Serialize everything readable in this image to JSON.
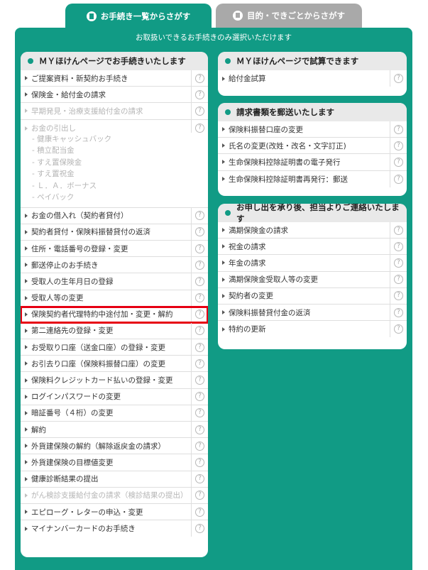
{
  "tabs": [
    {
      "label": "お手続き一覧からさがす",
      "active": true
    },
    {
      "label": "目的・できごとからさがす",
      "active": false
    }
  ],
  "notice": "お取扱いできるお手続きのみ選択いただけます",
  "help_glyph": "?",
  "left_box": {
    "title": "ＭＹほけんページでお手続きいたします",
    "items": [
      {
        "label": "ご提案資料・新契約お手続き",
        "disabled": false
      },
      {
        "label": "保険金・給付金の請求",
        "disabled": false
      },
      {
        "label": "早期発見・治療支援給付金の請求",
        "disabled": true
      },
      {
        "label": "お金の引出し",
        "disabled": true,
        "subs": [
          "- 健康キャッシュバック",
          "- 積立配当金",
          "- すえ置保険金",
          "- すえ置祝金",
          "- Ｌ．Ａ．ボーナス",
          "- ペイバック"
        ]
      },
      {
        "label": "お金の借入れ（契約者貸付）",
        "disabled": false
      },
      {
        "label": "契約者貸付・保険料振替貸付の返済",
        "disabled": false
      },
      {
        "label": "住所・電話番号の登録・変更",
        "disabled": false
      },
      {
        "label": "郵送停止のお手続き",
        "disabled": false
      },
      {
        "label": "受取人の生年月日の登録",
        "disabled": false
      },
      {
        "label": "受取人等の変更",
        "disabled": false
      },
      {
        "label": "保険契約者代理特約中途付加・変更・解約",
        "disabled": false,
        "highlight": true
      },
      {
        "label": "第二連絡先の登録・変更",
        "disabled": false
      },
      {
        "label": "お受取り口座（送金口座）の登録・変更",
        "disabled": false
      },
      {
        "label": "お引去り口座（保険料振替口座）の変更",
        "disabled": false
      },
      {
        "label": "保険料クレジットカード払いの登録・変更",
        "disabled": false
      },
      {
        "label": "ログインパスワードの変更",
        "disabled": false
      },
      {
        "label": "暗証番号（４桁）の変更",
        "disabled": false
      },
      {
        "label": "解約",
        "disabled": false
      },
      {
        "label": "外貨建保険の解約（解除返戻金の請求）",
        "disabled": false
      },
      {
        "label": "外貨建保険の目標値変更",
        "disabled": false
      },
      {
        "label": "健康診断結果の提出",
        "disabled": false
      },
      {
        "label": "がん検診支援給付金の請求（検診結果の提出）",
        "disabled": true
      },
      {
        "label": "エピローグ・レターの申込・変更",
        "disabled": false
      },
      {
        "label": "マイナンバーカードのお手続き",
        "disabled": false
      }
    ]
  },
  "right_box_1": {
    "title": "ＭＹほけんページで試算できます",
    "items": [
      {
        "label": "給付金試算",
        "disabled": false
      }
    ]
  },
  "right_box_2": {
    "title": "請求書類を郵送いたします",
    "items": [
      {
        "label": "保険料振替口座の変更",
        "disabled": false
      },
      {
        "label": "氏名の変更(改姓・改名・文字訂正)",
        "disabled": false
      },
      {
        "label": "生命保険料控除証明書の電子発行",
        "disabled": false
      },
      {
        "label": "生命保険料控除証明書再発行：郵送",
        "disabled": false
      }
    ]
  },
  "right_box_3": {
    "title": "お申し出を承り後、担当よりご連絡いたします",
    "items": [
      {
        "label": "満期保険金の請求",
        "disabled": false
      },
      {
        "label": "祝金の請求",
        "disabled": false
      },
      {
        "label": "年金の請求",
        "disabled": false
      },
      {
        "label": "満期保険金受取人等の変更",
        "disabled": false
      },
      {
        "label": "契約者の変更",
        "disabled": false
      },
      {
        "label": "保険料振替貸付金の返済",
        "disabled": false
      },
      {
        "label": "特約の更新",
        "disabled": false
      }
    ]
  },
  "colors": {
    "accent": "#119b85",
    "highlight": "#e60012",
    "disabled_text": "#b5b5b5",
    "inactive_tab": "#a9a9a9"
  }
}
